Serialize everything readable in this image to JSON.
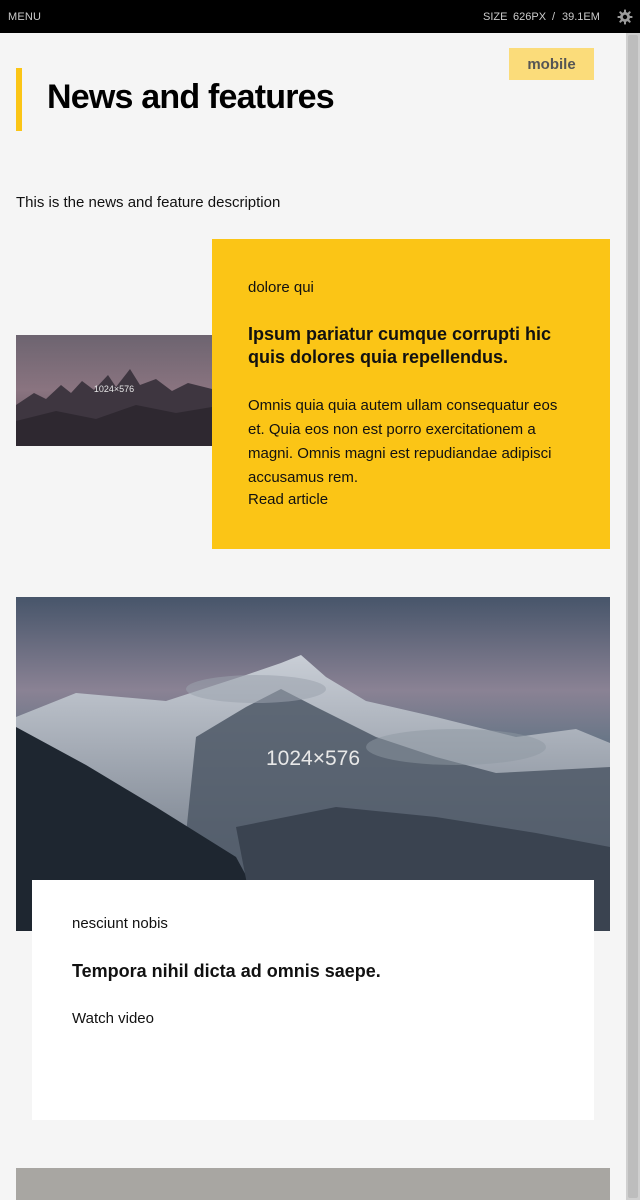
{
  "topbar": {
    "menu_label": "MENU",
    "size_label": "SIZE",
    "size_px": "626PX",
    "size_sep": "/",
    "size_em": "39.1EM",
    "settings_icon": "gear-icon"
  },
  "badge": {
    "label": "mobile"
  },
  "page": {
    "title": "News and features",
    "description": "This is the news and feature description",
    "accent_color": "#fbc516"
  },
  "cards": [
    {
      "image_label": "1024×576",
      "eyebrow": "dolore qui",
      "headline": "Ipsum pariatur cumque corrupti hic quis dolores quia repellendus.",
      "body": "Omnis quia quia autem ullam consequatur eos et. Quia eos non est porro exercitationem a magni. Omnis magni est repudiandae adipisci accusamus rem.",
      "link": "Read article"
    },
    {
      "image_label": "1024×576",
      "eyebrow": "nesciunt nobis",
      "headline": "Tempora nihil dicta ad omnis saepe.",
      "link": "Watch video"
    }
  ]
}
